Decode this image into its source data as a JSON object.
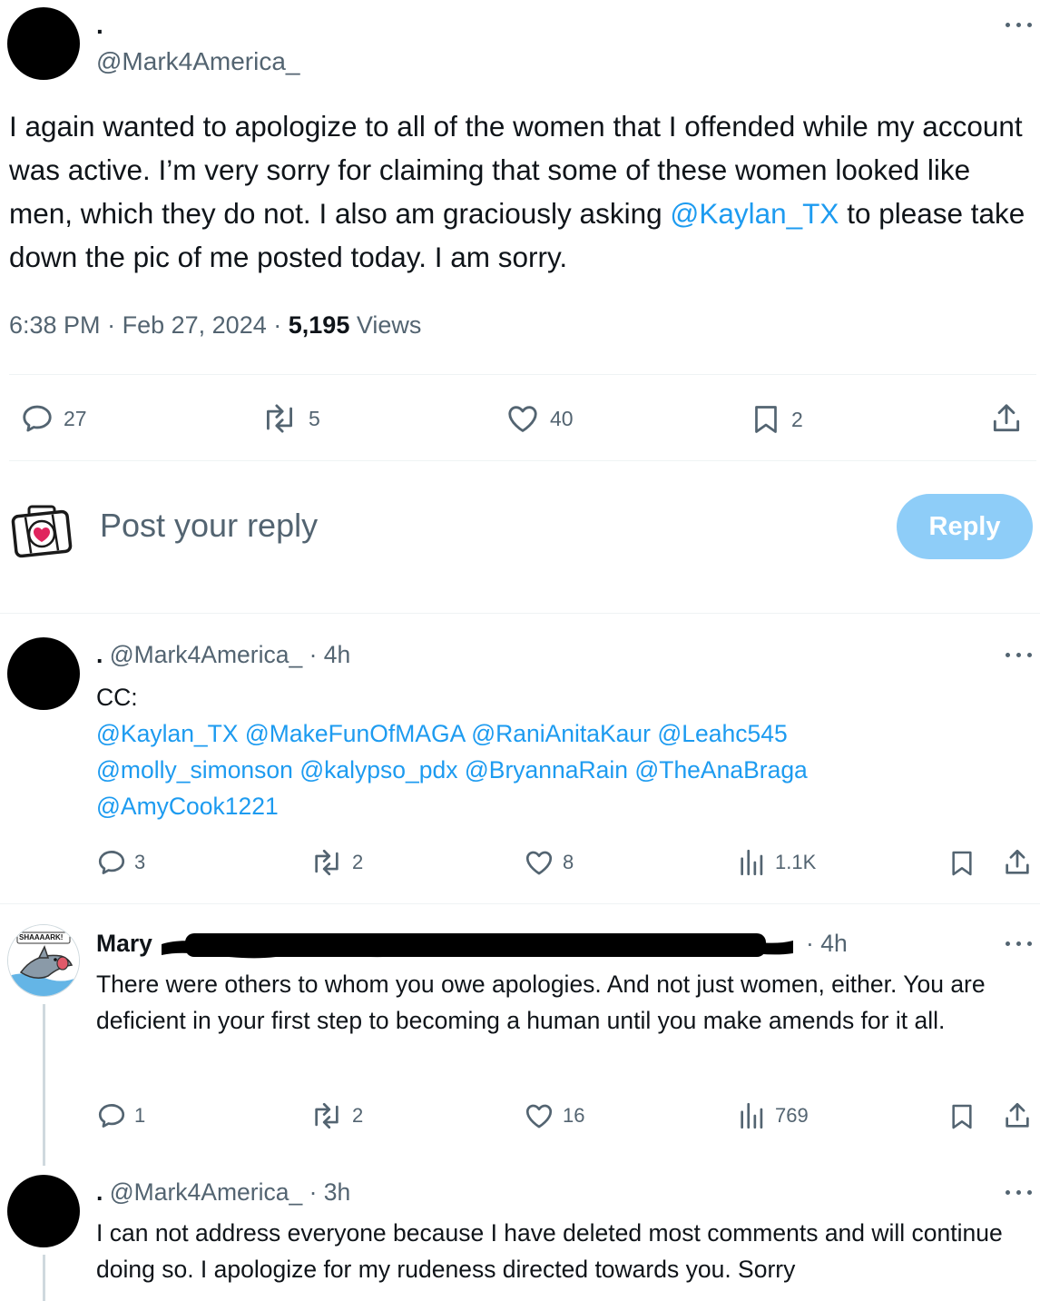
{
  "tweet": {
    "display_name": ".",
    "handle": "@Mark4America_",
    "text_before": "I again wanted to apologize to all of the women that I offended while my account was active. I’m very sorry for claiming that some of these women looked like men, which they do not. I also am graciously asking ",
    "mention": "@Kaylan_TX",
    "text_after": " to please take down the pic of me posted today. I am sorry.",
    "time": "6:38 PM",
    "date": "Feb 27, 2024",
    "views_count": "5,195",
    "views_label": "Views",
    "separator": "·",
    "stats": {
      "replies": "27",
      "reposts": "5",
      "likes": "40",
      "bookmarks": "2"
    }
  },
  "composer": {
    "placeholder": "Post your reply",
    "button_label": "Reply"
  },
  "replies": [
    {
      "display_name": ".",
      "handle": "@Mark4America_",
      "time": "4h",
      "separator": "·",
      "text_line1": "CC:",
      "mentions_line1": [
        "@Kaylan_TX",
        "@MakeFunOfMAGA",
        "@RaniAnitaKaur",
        "@Leahc545"
      ],
      "mentions_line2": [
        "@molly_simonson",
        "@kalypso_pdx",
        "@BryannaRain",
        "@TheAnaBraga"
      ],
      "mentions_line3": [
        "@AmyCook1221"
      ],
      "stats": {
        "replies": "3",
        "reposts": "2",
        "likes": "8",
        "views": "1.1K"
      }
    },
    {
      "display_name": "Mary",
      "time": "4h",
      "separator": "·",
      "avatar_caption": "SHAAAARK!",
      "text": "There were others to whom you owe apologies. And not just women, either. You are deficient in your first step to becoming a human until you make amends for it all.",
      "stats": {
        "replies": "1",
        "reposts": "2",
        "likes": "16",
        "views": "769"
      }
    },
    {
      "display_name": ".",
      "handle": "@Mark4America_",
      "time": "3h",
      "separator": "·",
      "text": "I can not address everyone because I have deleted most comments and will continue doing so. I apologize for my rudeness directed towards you. Sorry"
    }
  ],
  "colors": {
    "accent": "#1d9bf0",
    "text": "#0f1419",
    "muted": "#536471",
    "divider": "#eff3f4",
    "reply_button_disabled": "#8ecdf8"
  },
  "icons": [
    "more-icon",
    "reply-icon",
    "repost-icon",
    "like-icon",
    "bookmark-icon",
    "share-icon",
    "views-icon",
    "medkit-avatar-icon",
    "shark-avatar-icon"
  ]
}
